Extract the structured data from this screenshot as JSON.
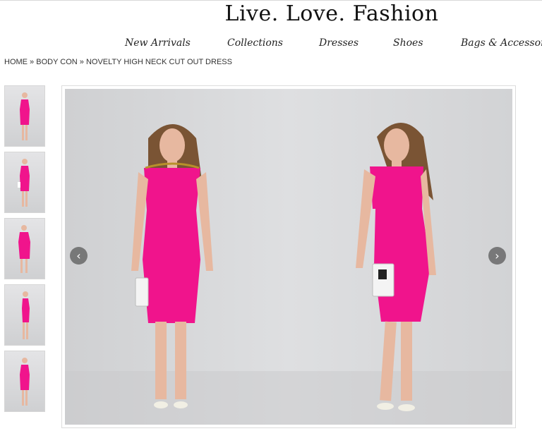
{
  "site": {
    "title": "Live. Love. Fashion"
  },
  "nav": {
    "items": [
      "New Arrivals",
      "Collections",
      "Dresses",
      "Shoes",
      "Bags & Accessories"
    ]
  },
  "breadcrumb": {
    "home": "HOME",
    "sep1": " » ",
    "category": "BODY CON",
    "sep2": " » ",
    "current": "NOVELTY HIGH NECK CUT OUT DRESS"
  },
  "gallery": {
    "thumbnail_count": 5,
    "prev_icon": "chevron-left-icon",
    "next_icon": "chevron-right-icon",
    "prev_glyph": "‹",
    "next_glyph": "›"
  },
  "colors": {
    "dress": "#f0148c",
    "background": "#d8d9db",
    "hair": "#7a5434",
    "skin": "#e7b8a0"
  }
}
